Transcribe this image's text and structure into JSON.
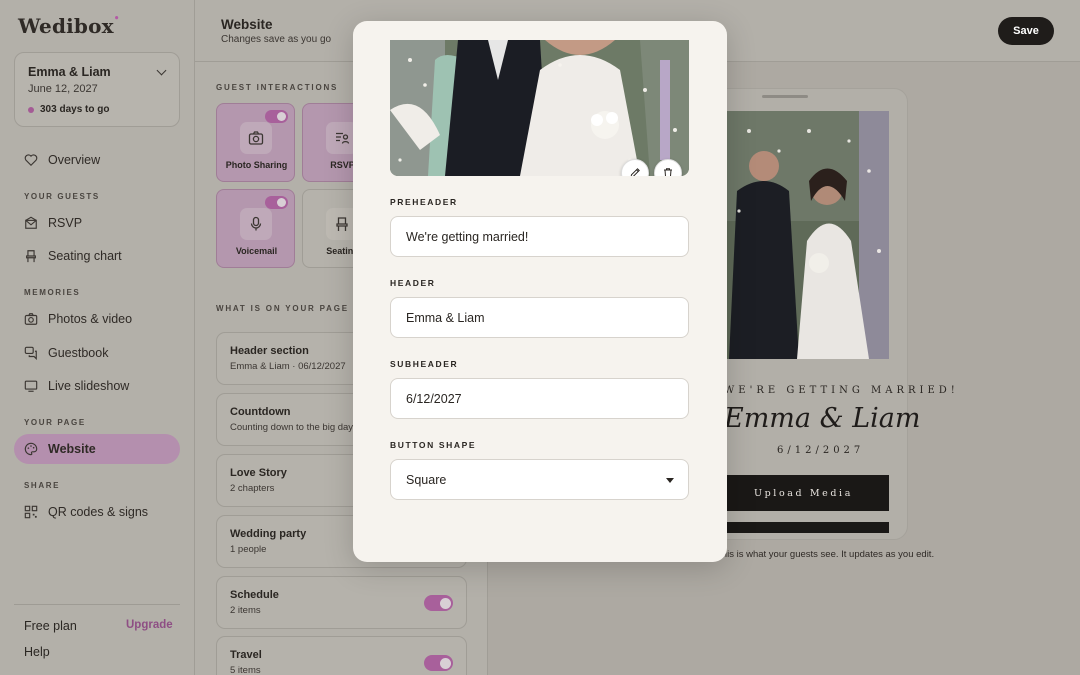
{
  "app": {
    "logo": "Wedibox",
    "colors": {
      "accent": "#a8609b",
      "dark": "#1f1c1a",
      "modal_bg": "#f6f3ee"
    }
  },
  "event": {
    "name": "Emma & Liam",
    "date": "June 12, 2027",
    "countdown": "303 days to go"
  },
  "sidebar": {
    "overview": "Overview",
    "sections": {
      "guests": "YOUR GUESTS",
      "memories": "MEMORIES",
      "page": "YOUR PAGE",
      "share": "SHARE"
    },
    "items": {
      "rsvp": "RSVP",
      "seating": "Seating chart",
      "photos": "Photos & video",
      "guestbook": "Guestbook",
      "slideshow": "Live slideshow",
      "website": "Website",
      "qr": "QR codes & signs"
    },
    "free_plan": "Free plan",
    "upgrade": "Upgrade",
    "help": "Help"
  },
  "header": {
    "title": "Website",
    "subtitle": "Changes save as you go",
    "save": "Save"
  },
  "editor": {
    "guest_interactions_label": "GUEST INTERACTIONS",
    "features": [
      {
        "label": "Photo Sharing",
        "icon": "camera-icon",
        "on": true
      },
      {
        "label": "RSVP",
        "icon": "rsvp-icon",
        "on": true
      },
      {
        "label": "Voicemail",
        "icon": "microphone-icon",
        "on": true
      },
      {
        "label": "Seating",
        "icon": "chair-icon",
        "on": false
      }
    ],
    "on_page_label": "WHAT IS ON YOUR PAGE",
    "sections": [
      {
        "title": "Header section",
        "subtitle": "Emma & Liam · 06/12/2027"
      },
      {
        "title": "Countdown",
        "subtitle": "Counting down to the big day"
      },
      {
        "title": "Love Story",
        "subtitle": "2 chapters"
      },
      {
        "title": "Wedding party",
        "subtitle": "1 people"
      },
      {
        "title": "Schedule",
        "subtitle": "2 items"
      },
      {
        "title": "Travel",
        "subtitle": "5 items"
      }
    ]
  },
  "preview": {
    "married": "WE'RE GETTING MARRIED!",
    "couple": "Emma & Liam",
    "date": "6/12/2027",
    "button": "Upload Media",
    "caption": "This is what your guests see. It updates as you edit."
  },
  "modal": {
    "preheader_label": "PREHEADER",
    "preheader_value": "We're getting married!",
    "header_label": "HEADER",
    "header_value": "Emma & Liam",
    "subheader_label": "SUBHEADER",
    "subheader_value": "6/12/2027",
    "button_shape_label": "BUTTON SHAPE",
    "button_shape_value": "Square"
  }
}
